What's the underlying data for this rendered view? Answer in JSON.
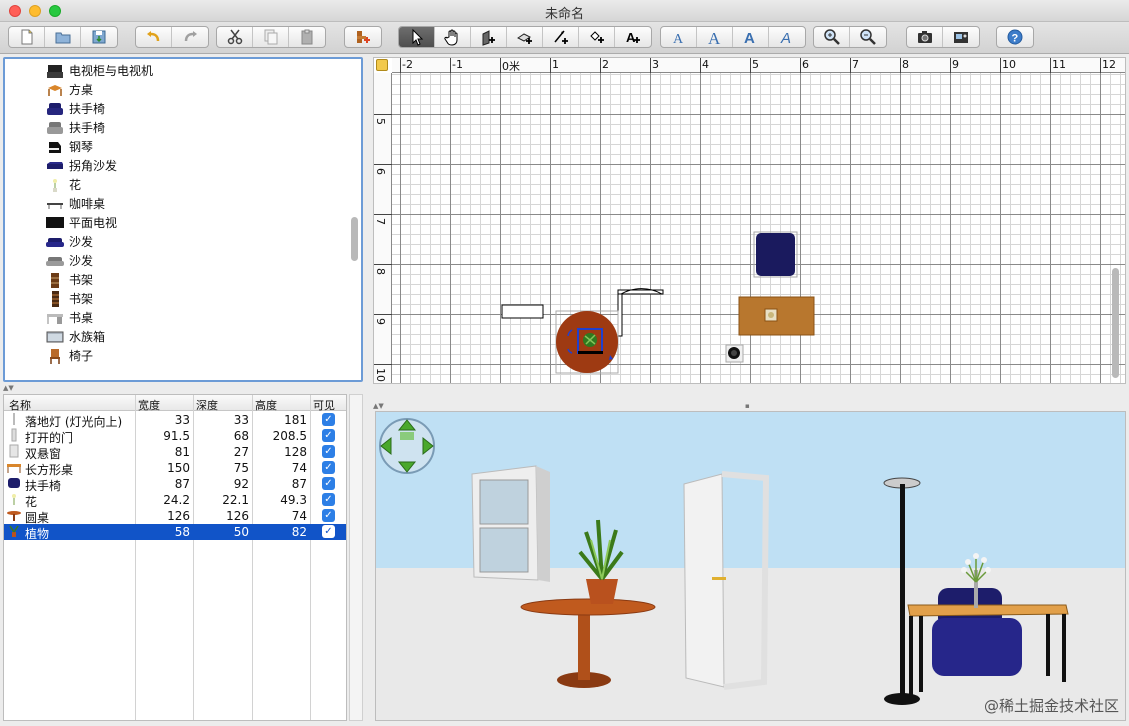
{
  "window": {
    "title": "未命名"
  },
  "catalog": {
    "items": [
      {
        "label": "电视柜与电视机",
        "icon": "tv-cabinet-icon"
      },
      {
        "label": "方桌",
        "icon": "square-table-icon"
      },
      {
        "label": "扶手椅",
        "icon": "armchair-blue-icon"
      },
      {
        "label": "扶手椅",
        "icon": "armchair-grey-icon"
      },
      {
        "label": "钢琴",
        "icon": "piano-icon"
      },
      {
        "label": "拐角沙发",
        "icon": "corner-sofa-icon"
      },
      {
        "label": "花",
        "icon": "flower-icon"
      },
      {
        "label": "咖啡桌",
        "icon": "coffee-table-icon"
      },
      {
        "label": "平面电视",
        "icon": "flat-tv-icon"
      },
      {
        "label": "沙发",
        "icon": "sofa-blue-icon"
      },
      {
        "label": "沙发",
        "icon": "sofa-grey-icon"
      },
      {
        "label": "书架",
        "icon": "bookshelf-icon"
      },
      {
        "label": "书架",
        "icon": "bookshelf-tall-icon"
      },
      {
        "label": "书桌",
        "icon": "desk-icon"
      },
      {
        "label": "水族箱",
        "icon": "aquarium-icon"
      },
      {
        "label": "椅子",
        "icon": "chair-icon"
      }
    ]
  },
  "furniture_table": {
    "headers": {
      "name": "名称",
      "width": "宽度",
      "depth": "深度",
      "height": "高度",
      "visible": "可见"
    },
    "rows": [
      {
        "name": "落地灯 (灯光向上)",
        "width": "33",
        "depth": "33",
        "height": "181",
        "visible": true,
        "selected": false
      },
      {
        "name": "打开的门",
        "width": "91.5",
        "depth": "68",
        "height": "208.5",
        "visible": true,
        "selected": false
      },
      {
        "name": "双悬窗",
        "width": "81",
        "depth": "27",
        "height": "128",
        "visible": true,
        "selected": false
      },
      {
        "name": "长方形桌",
        "width": "150",
        "depth": "75",
        "height": "74",
        "visible": true,
        "selected": false
      },
      {
        "name": "扶手椅",
        "width": "87",
        "depth": "92",
        "height": "87",
        "visible": true,
        "selected": false
      },
      {
        "name": "花",
        "width": "24.2",
        "depth": "22.1",
        "height": "49.3",
        "visible": true,
        "selected": false
      },
      {
        "name": "圆桌",
        "width": "126",
        "depth": "126",
        "height": "74",
        "visible": true,
        "selected": false
      },
      {
        "name": "植物",
        "width": "58",
        "depth": "50",
        "height": "82",
        "visible": true,
        "selected": true
      }
    ],
    "checkmark": "✓"
  },
  "plan": {
    "ruler_x": [
      "-2",
      "-1",
      "0米",
      "1",
      "2",
      "3",
      "4",
      "5",
      "6",
      "7",
      "8",
      "9",
      "10",
      "11",
      "12"
    ],
    "ruler_y": [
      "5",
      "6",
      "7",
      "8",
      "9",
      "10"
    ]
  },
  "colors": {
    "selection": "#1154c8",
    "catalog_focus": "#6c9bd6",
    "armchair_blue": "#1a1a5e",
    "table_wood": "#b8772e",
    "round_table": "#9e3a12",
    "sky": "#bfe0f4"
  },
  "watermark": "@稀土掘金技术社区"
}
